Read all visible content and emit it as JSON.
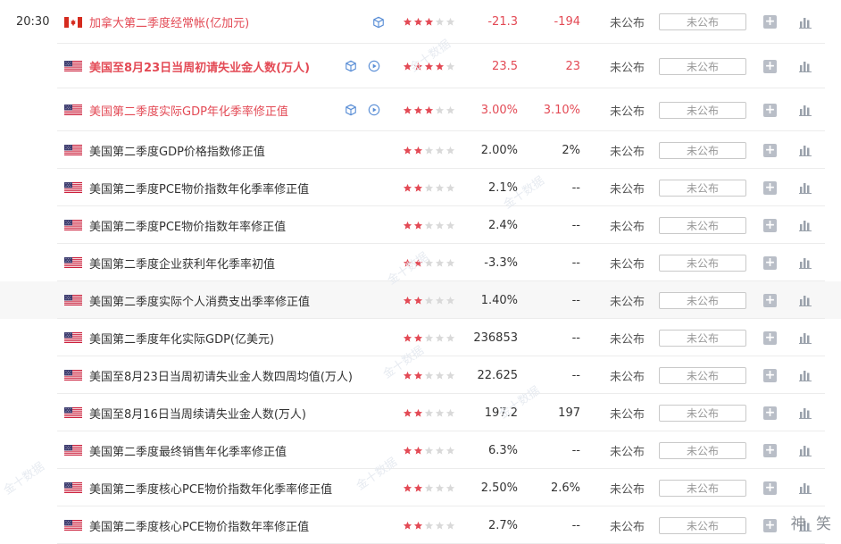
{
  "watermark_text": "金十数据",
  "brand_watermark": "神 笑",
  "colors": {
    "star_on": "#e34a55",
    "star_off": "#d9d9d9",
    "accent_red": "#e34a55"
  },
  "events": [
    {
      "time": "20:30",
      "flag": "canada-flag",
      "name": "加拿大第二季度经常帐(亿加元)",
      "stars": 3,
      "previous": "-21.3",
      "forecast": "-194",
      "actual": "未公布",
      "action": "未公布",
      "red": true,
      "bold": false,
      "icons": [
        "cube-icon"
      ]
    },
    {
      "time": "",
      "flag": "us-flag",
      "name": "美国至8月23日当周初请失业金人数(万人)",
      "stars": 4,
      "previous": "23.5",
      "forecast": "23",
      "actual": "未公布",
      "action": "未公布",
      "red": true,
      "bold": true,
      "icons": [
        "cube-icon",
        "play-icon"
      ]
    },
    {
      "time": "",
      "flag": "us-flag",
      "name": "美国第二季度实际GDP年化季率修正值",
      "stars": 3,
      "previous": "3.00%",
      "forecast": "3.10%",
      "actual": "未公布",
      "action": "未公布",
      "red": true,
      "bold": false,
      "icons": [
        "cube-icon",
        "play-icon"
      ]
    },
    {
      "time": "",
      "flag": "us-flag",
      "name": "美国第二季度GDP价格指数修正值",
      "stars": 2,
      "previous": "2.00%",
      "forecast": "2%",
      "actual": "未公布",
      "action": "未公布",
      "red": false,
      "bold": false,
      "icons": []
    },
    {
      "time": "",
      "flag": "us-flag",
      "name": "美国第二季度PCE物价指数年化季率修正值",
      "stars": 2,
      "previous": "2.1%",
      "forecast": "--",
      "actual": "未公布",
      "action": "未公布",
      "red": false,
      "bold": false,
      "icons": []
    },
    {
      "time": "",
      "flag": "us-flag",
      "name": "美国第二季度PCE物价指数年率修正值",
      "stars": 2,
      "previous": "2.4%",
      "forecast": "--",
      "actual": "未公布",
      "action": "未公布",
      "red": false,
      "bold": false,
      "icons": []
    },
    {
      "time": "",
      "flag": "us-flag",
      "name": "美国第二季度企业获利年化季率初值",
      "stars": 2,
      "previous": "-3.3%",
      "forecast": "--",
      "actual": "未公布",
      "action": "未公布",
      "red": false,
      "bold": false,
      "icons": []
    },
    {
      "time": "",
      "flag": "us-flag",
      "name": "美国第二季度实际个人消费支出季率修正值",
      "stars": 2,
      "previous": "1.40%",
      "forecast": "--",
      "actual": "未公布",
      "action": "未公布",
      "red": false,
      "bold": false,
      "icons": [],
      "highlight": true
    },
    {
      "time": "",
      "flag": "us-flag",
      "name": "美国第二季度年化实际GDP(亿美元)",
      "stars": 2,
      "previous": "236853",
      "forecast": "--",
      "actual": "未公布",
      "action": "未公布",
      "red": false,
      "bold": false,
      "icons": []
    },
    {
      "time": "",
      "flag": "us-flag",
      "name": "美国至8月23日当周初请失业金人数四周均值(万人)",
      "stars": 2,
      "previous": "22.625",
      "forecast": "--",
      "actual": "未公布",
      "action": "未公布",
      "red": false,
      "bold": false,
      "icons": []
    },
    {
      "time": "",
      "flag": "us-flag",
      "name": "美国至8月16日当周续请失业金人数(万人)",
      "stars": 2,
      "previous": "197.2",
      "forecast": "197",
      "actual": "未公布",
      "action": "未公布",
      "red": false,
      "bold": false,
      "icons": []
    },
    {
      "time": "",
      "flag": "us-flag",
      "name": "美国第二季度最终销售年化季率修正值",
      "stars": 2,
      "previous": "6.3%",
      "forecast": "--",
      "actual": "未公布",
      "action": "未公布",
      "red": false,
      "bold": false,
      "icons": []
    },
    {
      "time": "",
      "flag": "us-flag",
      "name": "美国第二季度核心PCE物价指数年化季率修正值",
      "stars": 2,
      "previous": "2.50%",
      "forecast": "2.6%",
      "actual": "未公布",
      "action": "未公布",
      "red": false,
      "bold": false,
      "icons": []
    },
    {
      "time": "",
      "flag": "us-flag",
      "name": "美国第二季度核心PCE物价指数年率修正值",
      "stars": 2,
      "previous": "2.7%",
      "forecast": "--",
      "actual": "未公布",
      "action": "未公布",
      "red": false,
      "bold": false,
      "icons": []
    }
  ]
}
